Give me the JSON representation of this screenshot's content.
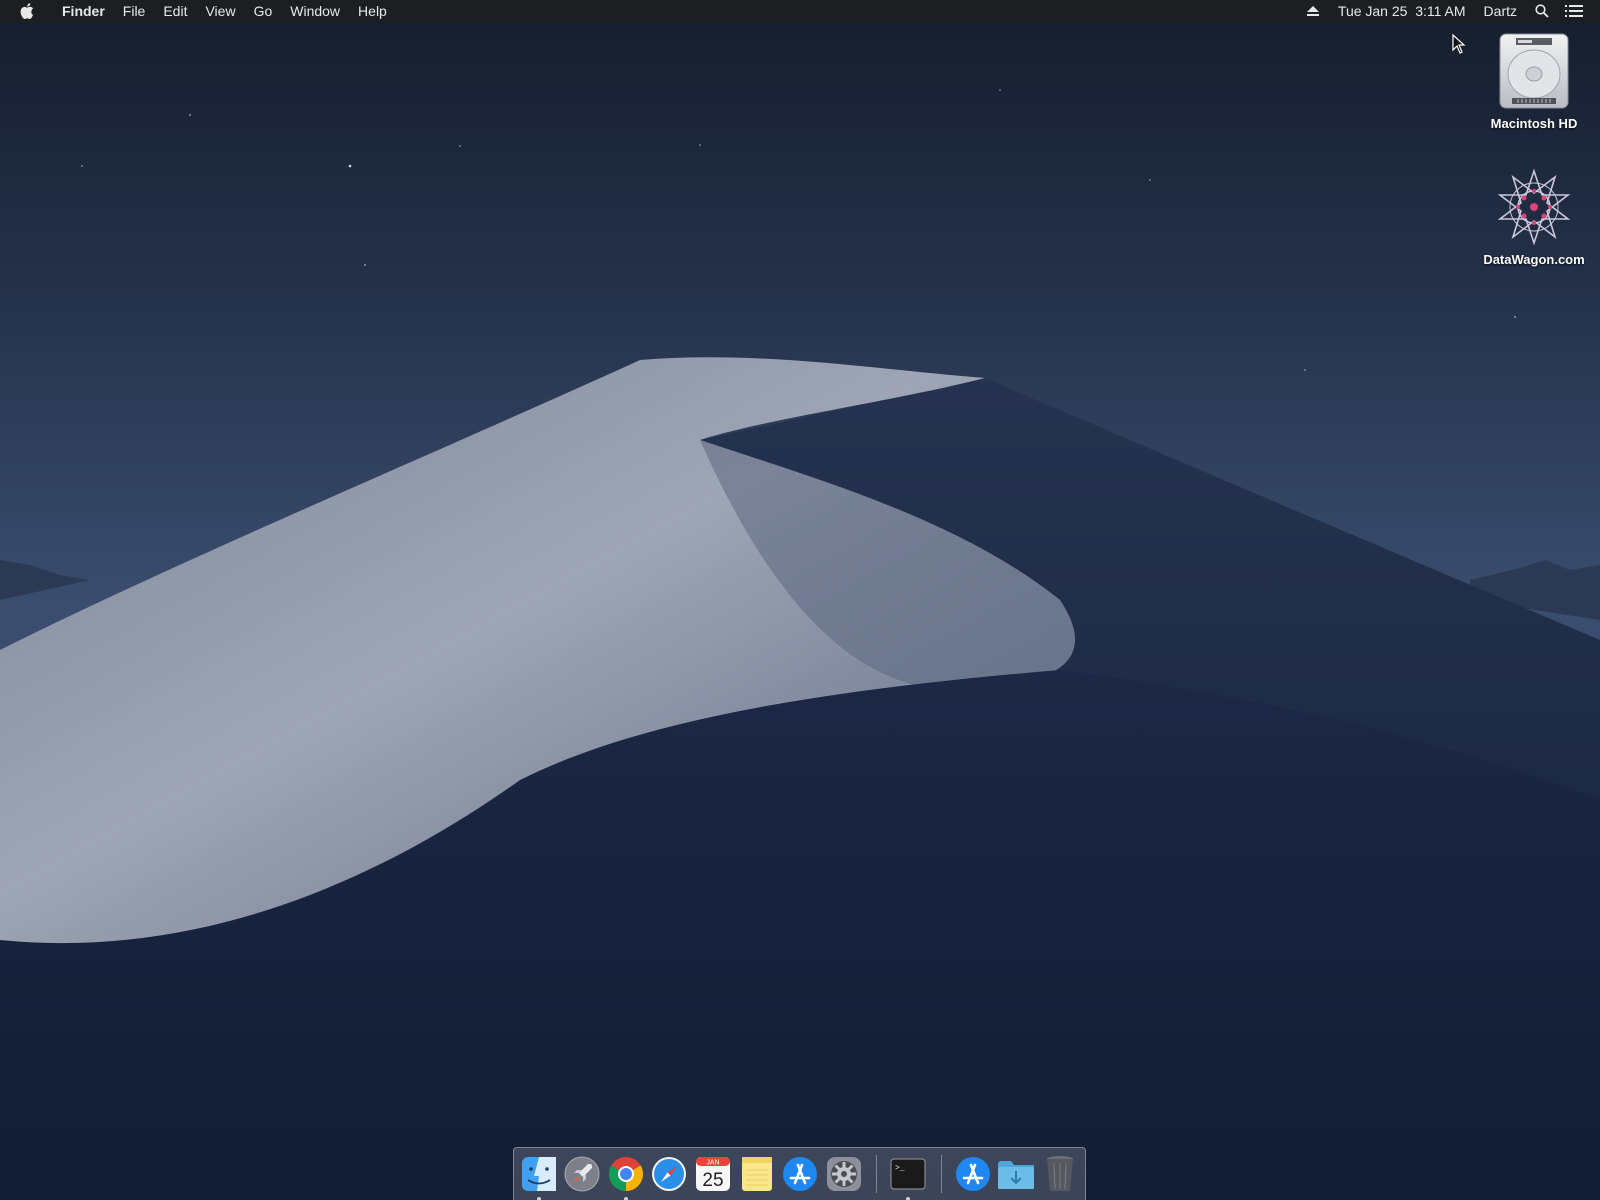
{
  "menubar": {
    "apple_icon": "apple-logo-icon",
    "app_name": "Finder",
    "menus": [
      "File",
      "Edit",
      "View",
      "Go",
      "Window",
      "Help"
    ],
    "eject_icon": "eject-icon",
    "datetime": "Tue Jan 25  3:11 AM",
    "user": "Dartz",
    "spotlight_icon": "search-icon",
    "notification_icon": "list-icon"
  },
  "desktop": {
    "icons": [
      {
        "label": "Macintosh HD",
        "icon": "hard-drive-icon"
      },
      {
        "label": "DataWagon.com",
        "icon": "network-star-icon"
      }
    ]
  },
  "dock": {
    "apps": [
      {
        "name": "Finder",
        "icon": "finder-icon",
        "running": true
      },
      {
        "name": "Launchpad",
        "icon": "rocket-icon",
        "running": false
      },
      {
        "name": "Google Chrome",
        "icon": "chrome-icon",
        "running": true
      },
      {
        "name": "Safari",
        "icon": "compass-icon",
        "running": false
      },
      {
        "name": "Calendar",
        "icon": "calendar-icon",
        "running": false,
        "month": "JAN",
        "day": "25"
      },
      {
        "name": "Notes",
        "icon": "notes-icon",
        "running": false
      },
      {
        "name": "App Store",
        "icon": "app-store-icon",
        "running": false
      },
      {
        "name": "System Preferences",
        "icon": "gear-icon",
        "running": false
      },
      {
        "name": "Terminal",
        "icon": "terminal-icon",
        "running": true,
        "prompt": ">_"
      }
    ],
    "right_items": [
      {
        "name": "Applications",
        "icon": "app-store-icon"
      },
      {
        "name": "Downloads",
        "icon": "folder-icon"
      },
      {
        "name": "Trash",
        "icon": "trash-icon"
      }
    ]
  },
  "colors": {
    "menubar": "#1e1e20",
    "sky": "#26344c",
    "dune_light": "#8b93a6",
    "dune_dark": "#182440"
  }
}
